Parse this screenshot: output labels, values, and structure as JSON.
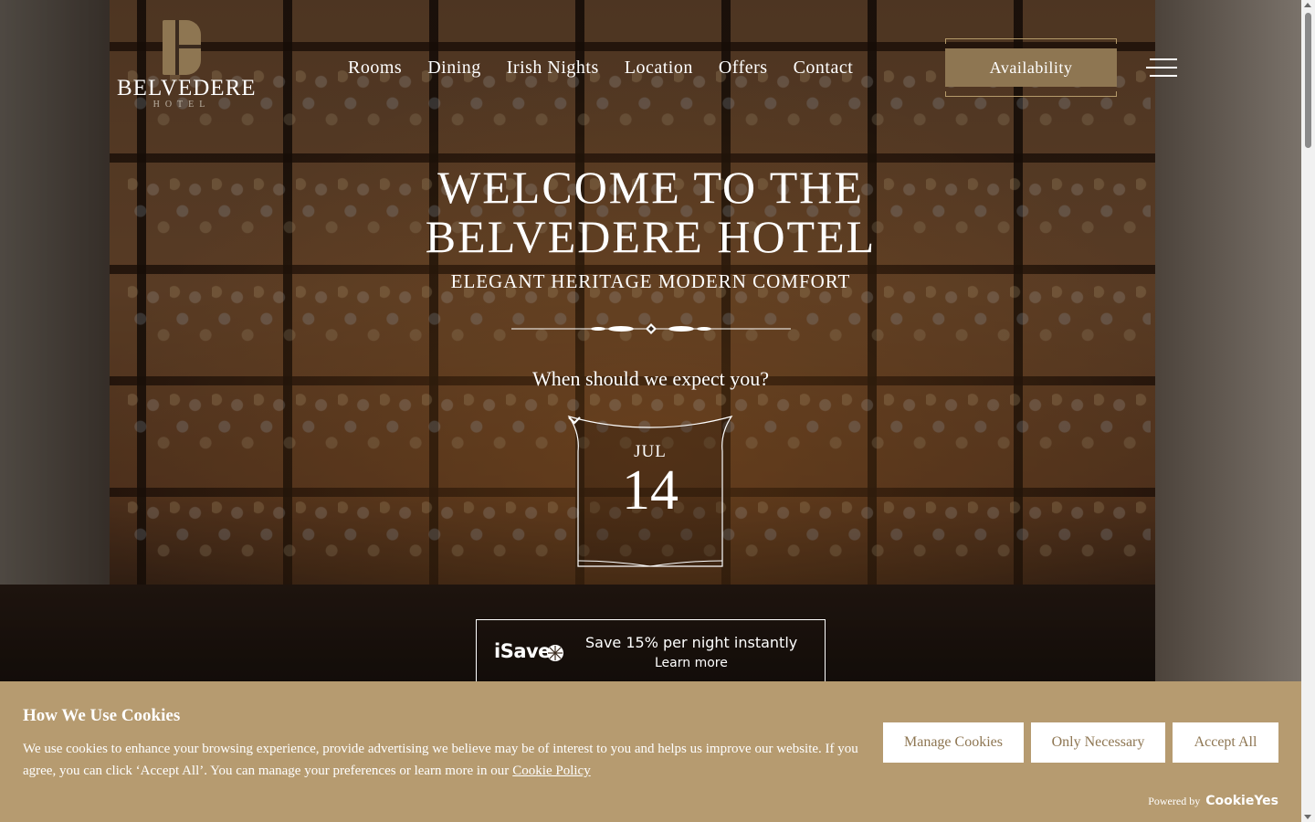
{
  "brand": {
    "name": "BELVEDERE",
    "sub": "HOTEL"
  },
  "nav": {
    "items": [
      "Rooms",
      "Dining",
      "Irish Nights",
      "Location",
      "Offers",
      "Contact"
    ]
  },
  "header": {
    "availability_label": "Availability",
    "menu_icon": "hamburger-icon"
  },
  "hero": {
    "title_line1": "WELCOME TO THE",
    "title_line2": "BELVEDERE HOTEL",
    "subtitle": "ELEGANT HERITAGE MODERN COMFORT",
    "question": "When should we expect you?",
    "date": {
      "month": "JUL",
      "day": "14"
    }
  },
  "promo": {
    "brand": "iSave",
    "headline": "Save 15% per night instantly",
    "link": "Learn more"
  },
  "cookie_banner": {
    "title": "How We Use Cookies",
    "text": "We use cookies to enhance your browsing experience, provide advertising we believe may be of interest to you and helps us improve our website. If you agree, you can click ‘Accept All’. You can manage your preferences or learn more in our",
    "policy_link": "Cookie Policy",
    "buttons": {
      "manage": "Manage Cookies",
      "necessary": "Only Necessary",
      "accept": "Accept All"
    },
    "powered_by": "Powered by",
    "powered_brand": "CookieYes"
  },
  "colors": {
    "gold": "#8e7652",
    "banner": "#b69b70",
    "white": "#ffffff"
  }
}
